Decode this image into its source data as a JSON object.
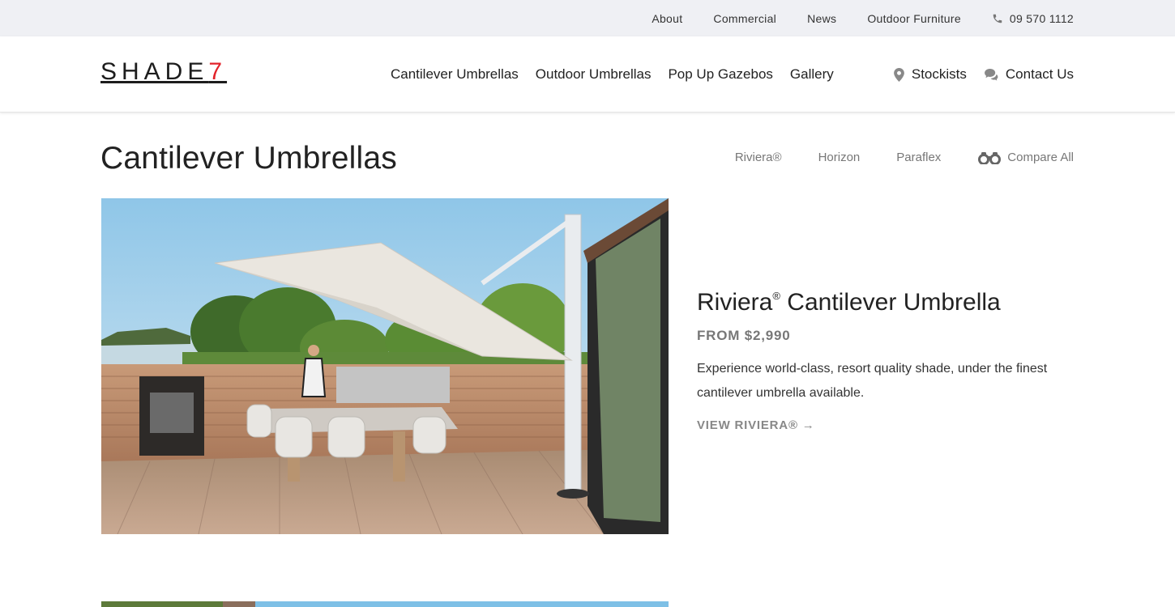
{
  "topbar": {
    "links": [
      {
        "label": "About"
      },
      {
        "label": "Commercial"
      },
      {
        "label": "News"
      },
      {
        "label": "Outdoor Furniture"
      }
    ],
    "phone": {
      "icon": "phone-icon",
      "label": "09 570 1112"
    }
  },
  "header": {
    "logo": {
      "text": "SHADE",
      "accent_text": "7",
      "accent_color": "#e2232a"
    },
    "nav": [
      {
        "label": "Cantilever Umbrellas"
      },
      {
        "label": "Outdoor Umbrellas"
      },
      {
        "label": "Pop Up Gazebos"
      },
      {
        "label": "Gallery"
      }
    ],
    "right_nav": [
      {
        "icon": "map-pin-icon",
        "label": "Stockists"
      },
      {
        "icon": "chat-bubbles-icon",
        "label": "Contact Us"
      }
    ]
  },
  "page": {
    "title": "Cantilever Umbrellas",
    "subnav": [
      {
        "label": "Riviera®"
      },
      {
        "label": "Horizon"
      },
      {
        "label": "Paraflex"
      },
      {
        "label": "Compare All",
        "icon": "binoculars-icon"
      }
    ]
  },
  "products": [
    {
      "name": "Riviera",
      "name_mark": "®",
      "name_suffix": "Cantilever Umbrella",
      "price": "FROM $2,990",
      "description": "Experience world-class, resort quality shade, under the finest cantilever umbrella available.",
      "link_label": "VIEW RIVIERA® →",
      "image_alt": "Cantilever umbrella over outdoor dining deck by the sea"
    }
  ]
}
